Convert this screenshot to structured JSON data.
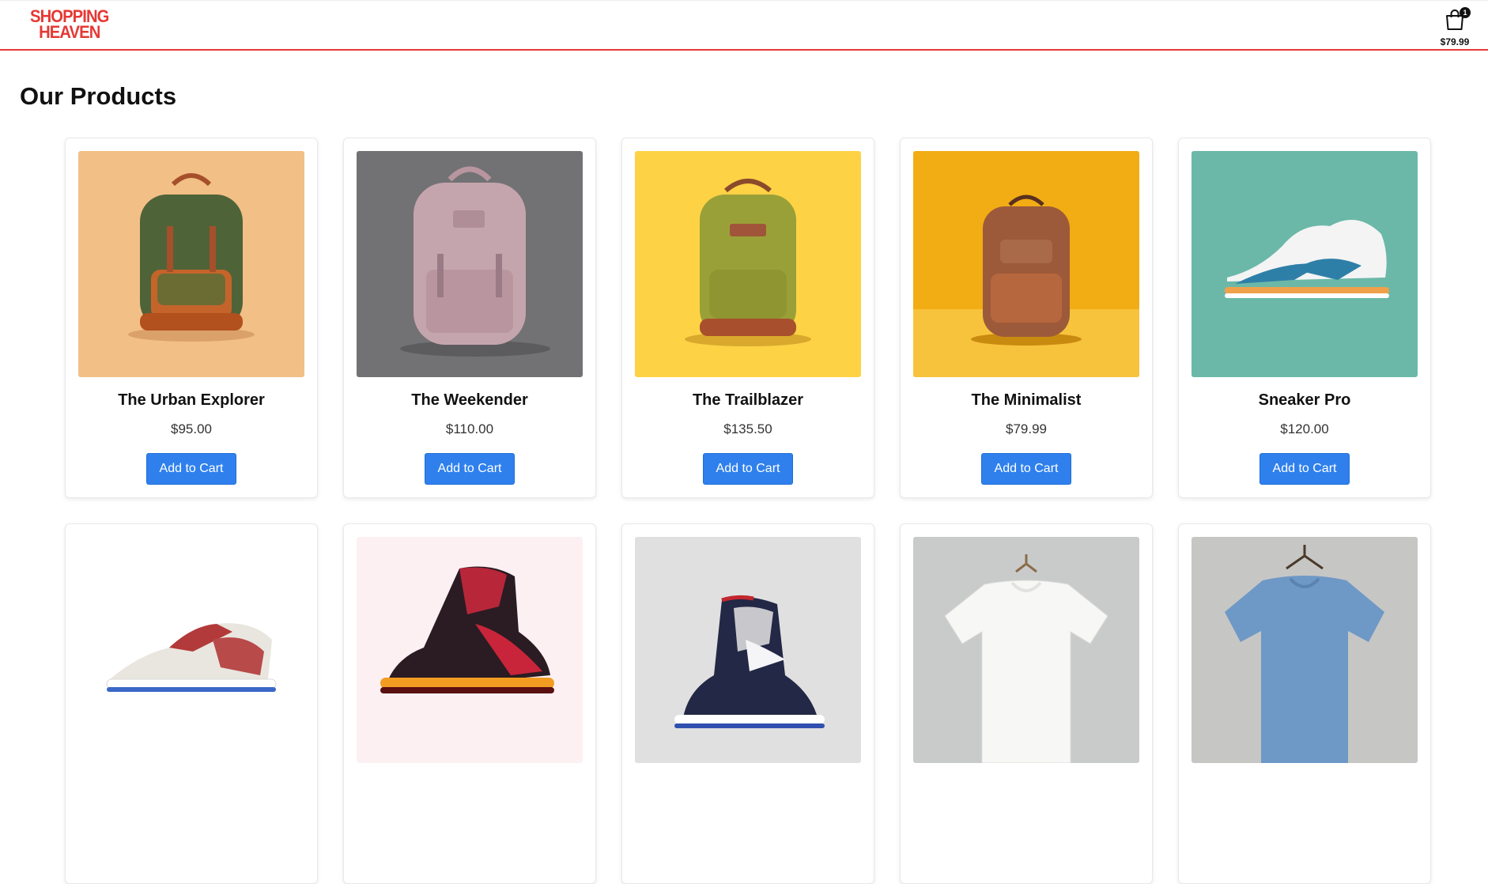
{
  "header": {
    "logo_line1": "SHOPPING",
    "logo_line2": "HEAVEN",
    "cart_count": "1",
    "cart_total": "$79.99",
    "accent_color": "#e53935"
  },
  "main": {
    "title": "Our Products",
    "button_color": "#2f80ed",
    "products": [
      {
        "name": "The Urban Explorer",
        "price": "$95.00",
        "button": "Add to Cart",
        "bg": "#f2bf86"
      },
      {
        "name": "The Weekender",
        "price": "$110.00",
        "button": "Add to Cart",
        "bg": "#727274"
      },
      {
        "name": "The Trailblazer",
        "price": "$135.50",
        "button": "Add to Cart",
        "bg": "#fdd245"
      },
      {
        "name": "The Minimalist",
        "price": "$79.99",
        "button": "Add to Cart",
        "bg": "#f2ac14"
      },
      {
        "name": "Sneaker Pro",
        "price": "$120.00",
        "button": "Add to Cart",
        "bg": "#6bb8a8"
      },
      {
        "name": "",
        "price": "",
        "button": "",
        "bg": "#ffffff"
      },
      {
        "name": "",
        "price": "",
        "button": "",
        "bg": "#fdf0f3"
      },
      {
        "name": "",
        "price": "",
        "button": "",
        "bg": "#e0e0e0"
      },
      {
        "name": "",
        "price": "",
        "button": "",
        "bg": "#c9cbcb"
      },
      {
        "name": "",
        "price": "",
        "button": "",
        "bg": "#c6c6c4"
      }
    ]
  }
}
